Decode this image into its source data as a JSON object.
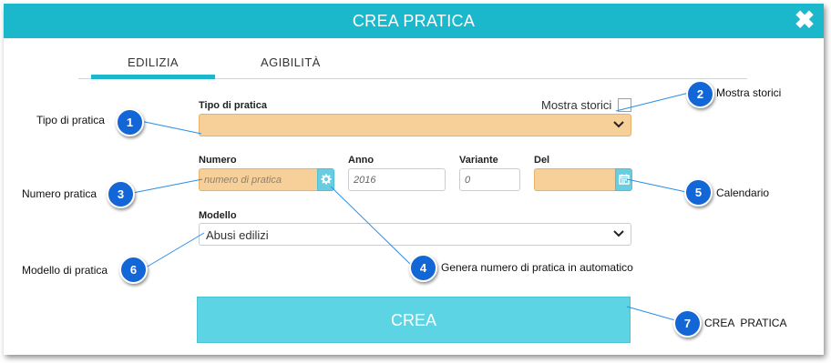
{
  "dialog": {
    "title": "CREA PRATICA",
    "close_icon": "close-icon",
    "tabs": [
      {
        "label": "EDILIZIA",
        "active": true
      },
      {
        "label": "AGIBILITÀ",
        "active": false
      }
    ],
    "mostra_storici_label": "Mostra storici",
    "tipo_pratica": {
      "label": "Tipo di pratica",
      "value": ""
    },
    "numero": {
      "label": "Numero",
      "placeholder": "numero di pratica",
      "generate_icon": "gear-icon"
    },
    "anno": {
      "label": "Anno",
      "placeholder": "2016"
    },
    "variante": {
      "label": "Variante",
      "placeholder": "0"
    },
    "del": {
      "label": "Del",
      "value": "",
      "calendar_icon": "calendar-icon"
    },
    "modello": {
      "label": "Modello",
      "value": "Abusi edilizi"
    },
    "create_button": "CREA"
  },
  "colors": {
    "header": "#1bb8cc",
    "highlight_field": "#f7cf98",
    "create_button": "#5cd4e3",
    "badge": "#1366d6"
  },
  "annotations": [
    {
      "number": "1",
      "text": "Tipo di pratica"
    },
    {
      "number": "2",
      "text": "Mostra storici"
    },
    {
      "number": "3",
      "text": "Numero pratica"
    },
    {
      "number": "4",
      "text": "Genera numero di pratica in automatico"
    },
    {
      "number": "5",
      "text": "Calendario"
    },
    {
      "number": "6",
      "text": "Modello di pratica"
    },
    {
      "number": "7",
      "text": "CREA  PRATICA"
    }
  ]
}
